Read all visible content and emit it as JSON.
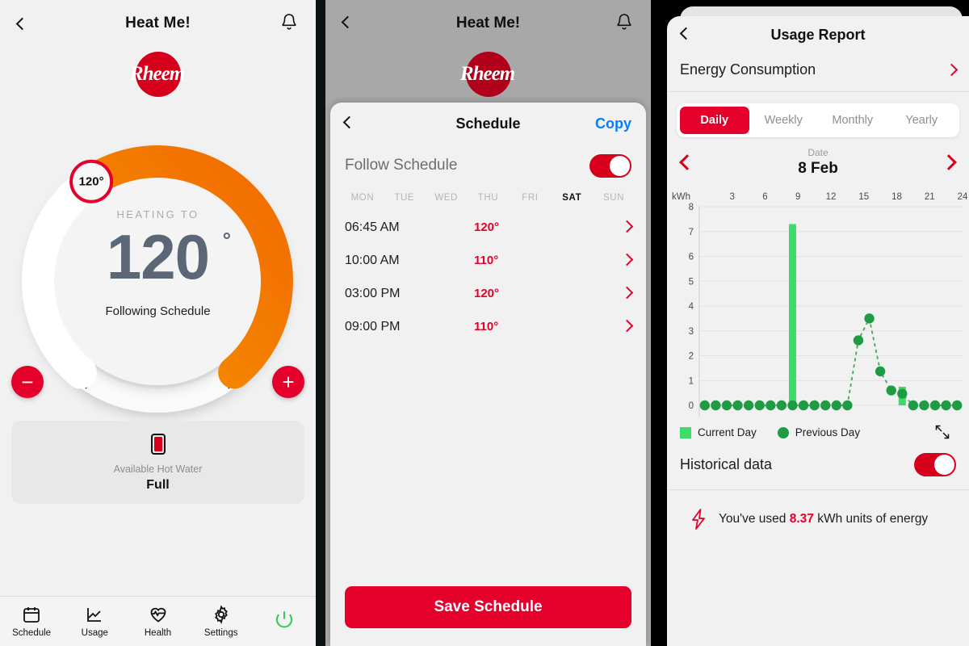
{
  "colors": {
    "brand_red": "#e4002b",
    "logo_red": "#d6001c",
    "orange_arc": "#f57c00",
    "gauge_text": "#5b6776",
    "link_blue": "#0a7bff",
    "current_day_green": "#3ddc6a",
    "previous_day_green": "#1f9c43",
    "power_green": "#2ecc57"
  },
  "panel1": {
    "topbar": {
      "title": "Heat Me!",
      "back_icon": "chevron-left-icon",
      "bell_icon": "bell-icon"
    },
    "logo_text": "Rheem",
    "gauge": {
      "thumb_value": "120°",
      "heading_label": "HEATING TO",
      "temperature": "120",
      "degree_symbol": "°",
      "status": "Following Schedule",
      "min_value": 0,
      "max_value": 100,
      "current_percent": 62
    },
    "decrease_label": "−",
    "increase_label": "+",
    "hot_water_card": {
      "icon": "water-tank-icon",
      "label": "Available Hot Water",
      "value": "Full"
    },
    "tabbar": [
      {
        "label": "Schedule",
        "icon": "calendar-icon"
      },
      {
        "label": "Usage",
        "icon": "line-chart-icon"
      },
      {
        "label": "Health",
        "icon": "heart-pulse-icon"
      },
      {
        "label": "Settings",
        "icon": "gear-icon"
      },
      {
        "label": "",
        "icon": "power-icon"
      }
    ]
  },
  "panel2": {
    "topbar": {
      "title": "Heat Me!",
      "back_icon": "chevron-left-icon",
      "bell_icon": "bell-icon"
    },
    "logo_text": "Rheem",
    "sheet": {
      "back_icon": "chevron-left-icon",
      "title": "Schedule",
      "copy_label": "Copy",
      "follow_label": "Follow Schedule",
      "follow_enabled": true,
      "days": [
        {
          "label": "MON",
          "active": false
        },
        {
          "label": "TUE",
          "active": false
        },
        {
          "label": "WED",
          "active": false
        },
        {
          "label": "THU",
          "active": false
        },
        {
          "label": "FRI",
          "active": false
        },
        {
          "label": "SAT",
          "active": true
        },
        {
          "label": "SUN",
          "active": false
        }
      ],
      "rows": [
        {
          "time": "06:45 AM",
          "temp": "120°"
        },
        {
          "time": "10:00 AM",
          "temp": "110°"
        },
        {
          "time": "03:00 PM",
          "temp": "120°"
        },
        {
          "time": "09:00 PM",
          "temp": "110°"
        }
      ],
      "save_label": "Save Schedule"
    }
  },
  "panel3": {
    "back_icon": "chevron-left-icon",
    "title": "Usage Report",
    "energy_consumption": {
      "label": "Energy Consumption",
      "chevron": "chevron-right-icon"
    },
    "segments": [
      {
        "label": "Daily",
        "active": true
      },
      {
        "label": "Weekly",
        "active": false
      },
      {
        "label": "Monthly",
        "active": false
      },
      {
        "label": "Yearly",
        "active": false
      }
    ],
    "date_nav": {
      "prev_icon": "chevron-left-icon",
      "next_icon": "chevron-right-icon",
      "label": "Date",
      "value": "8 Feb"
    },
    "legend": [
      {
        "label": "Current Day",
        "marker": "square"
      },
      {
        "label": "Previous Day",
        "marker": "circle"
      }
    ],
    "expand_icon": "expand-diagonal-icon",
    "historical_data": {
      "label": "Historical data",
      "enabled": true
    },
    "energy_used": {
      "icon": "lightning-bolt-icon",
      "prefix": "You've used",
      "value": "8.37",
      "suffix": "kWh units of energy"
    }
  },
  "chart_data": {
    "type": "bar",
    "title": "",
    "xlabel": "",
    "ylabel": "kWh",
    "ylim": [
      0,
      8
    ],
    "yticks": [
      0,
      1,
      2,
      3,
      4,
      5,
      6,
      7,
      8
    ],
    "xticks": [
      3,
      6,
      9,
      12,
      15,
      18,
      21,
      24
    ],
    "xlim": [
      0,
      24
    ],
    "grid": true,
    "legend_position": "below-left",
    "x": [
      1,
      2,
      3,
      4,
      5,
      6,
      7,
      8,
      9,
      10,
      11,
      12,
      13,
      14,
      15,
      16,
      17,
      18,
      19,
      20,
      21,
      22,
      23,
      24
    ],
    "series": [
      {
        "name": "Current Day",
        "type": "bar",
        "color": "#3ddc6a",
        "values": [
          0,
          0,
          0,
          0,
          0,
          0,
          0,
          0,
          7.3,
          0,
          0,
          0,
          0,
          0,
          0,
          0,
          0,
          0,
          0.75,
          0,
          0,
          0,
          0,
          0
        ]
      },
      {
        "name": "Previous Day",
        "type": "line-scatter-dashed",
        "color": "#1f9c43",
        "values": [
          0,
          0,
          0,
          0,
          0,
          0,
          0,
          0,
          0,
          0,
          0,
          0,
          0,
          0,
          2.62,
          3.5,
          1.37,
          0.6,
          0.47,
          0,
          0,
          0,
          0,
          0
        ]
      }
    ]
  }
}
